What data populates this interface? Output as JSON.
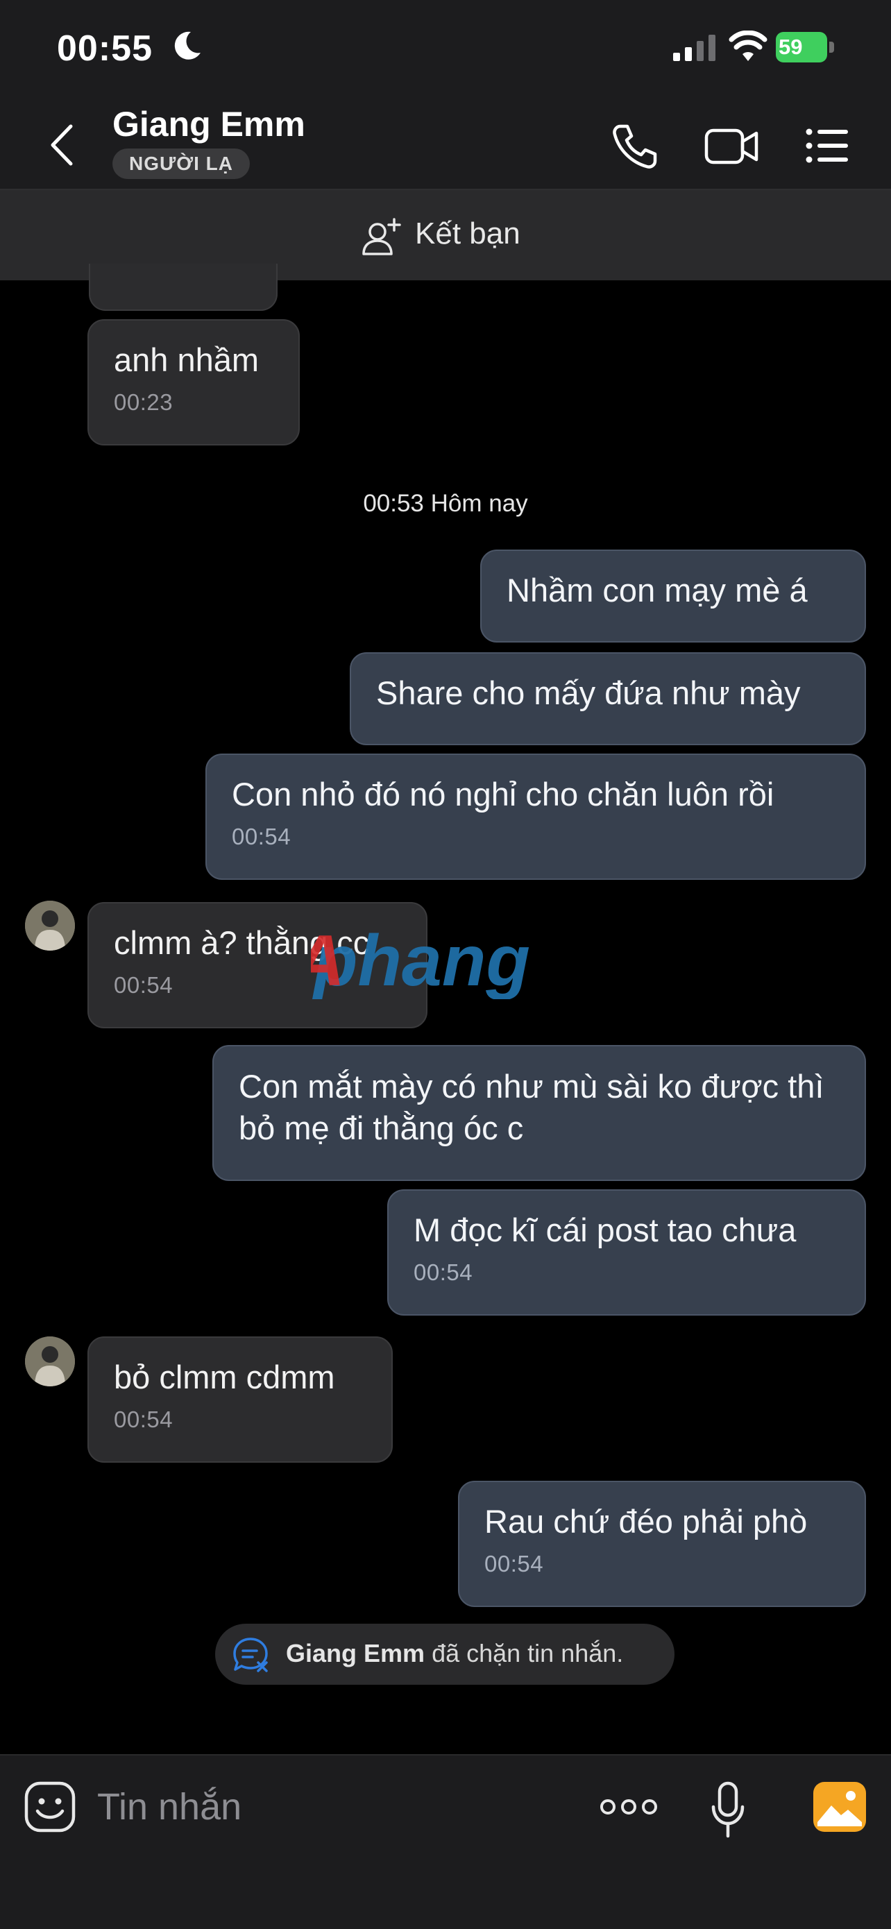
{
  "status_bar": {
    "time": "00:55",
    "battery": "59"
  },
  "header": {
    "name": "Giang Emm",
    "badge": "NGƯỜI LẠ"
  },
  "add_friend": {
    "label": "Kết bạn"
  },
  "date_separator": "00:53 Hôm nay",
  "messages": [
    {
      "dir": "in",
      "text": "anh nhầm",
      "time": "00:23"
    },
    {
      "dir": "out",
      "text": "Nhầm con mạy mè á",
      "time": ""
    },
    {
      "dir": "out",
      "text": "Share cho mấy đứa như mày",
      "time": ""
    },
    {
      "dir": "out",
      "text": "Con nhỏ đó nó nghỉ cho chăn luôn rồi",
      "time": "00:54"
    },
    {
      "dir": "in",
      "text": "clmm à? thằng cc",
      "time": "00:54"
    },
    {
      "dir": "out",
      "text": "Con mắt mày có như mù sài ko được thì bỏ mẹ đi thằng óc c",
      "time": ""
    },
    {
      "dir": "out",
      "text": "M đọc kĩ cái post tao chưa",
      "time": "00:54"
    },
    {
      "dir": "in",
      "text": "bỏ clmm cdmm",
      "time": "00:54"
    },
    {
      "dir": "out",
      "text": "Rau chứ đéo phải phò",
      "time": "00:54"
    }
  ],
  "blocked_notice": {
    "name": "Giang Emm",
    "text": "đã chặn tin nhắn."
  },
  "watermark": "Aphang",
  "composer": {
    "placeholder": "Tin nhắn"
  },
  "colors": {
    "outgoing_bubble": "#37404e",
    "incoming_bubble": "#2c2c2e",
    "badge": "#3a3a3c",
    "battery": "#3fcf5e",
    "photo_button": "#f5a623"
  },
  "icons": [
    "back-icon",
    "phone-icon",
    "video-icon",
    "menu-icon",
    "add-friend-icon",
    "sticker-icon",
    "more-icon",
    "mic-icon",
    "photo-icon",
    "blocked-icon"
  ]
}
